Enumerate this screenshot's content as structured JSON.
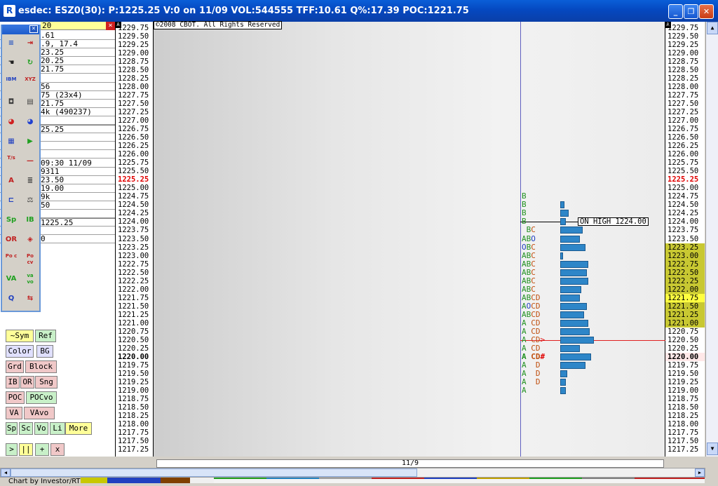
{
  "window": {
    "title": "esdec: ESZ0(30): P:1225.25 V:0 on 11/09 VOL:544555 TFF:10.61 Q%:17.39 POC:1221.75",
    "minimize": "_",
    "maximize": "❐",
    "close": "✕"
  },
  "left_panel": {
    "field_value": "20",
    "rows": [
      ".61",
      ".9, 17.4",
      "23.25",
      "20.25",
      "21.75",
      "",
      "56",
      "75 (23x4)",
      "21.75",
      "4k (490237)",
      "",
      "25.25",
      "",
      "",
      "",
      "09:30 11/09",
      "9311",
      "23.50",
      "19.00",
      "9k",
      "50",
      "",
      "1225.25",
      "",
      "0"
    ]
  },
  "toolbox": {
    "close": "×",
    "tools": [
      {
        "icon": "grid-lines-icon",
        "glyph": "≡",
        "color": "#2050c0"
      },
      {
        "icon": "import-arrow-icon",
        "glyph": "⇥",
        "color": "#c02020"
      },
      {
        "icon": "hand-icon",
        "glyph": "☚",
        "color": "#202020"
      },
      {
        "icon": "refresh-icon",
        "glyph": "↻",
        "color": "#20a020"
      },
      {
        "icon": "ibm-check-icon",
        "glyph": "IBM",
        "color": "#2040c0"
      },
      {
        "icon": "xyz-icon",
        "glyph": "XYZ",
        "color": "#c02020"
      },
      {
        "icon": "camera-icon",
        "glyph": "◘",
        "color": "#404040"
      },
      {
        "icon": "notepad-icon",
        "glyph": "▤",
        "color": "#404040"
      },
      {
        "icon": "color-wheel-icon",
        "glyph": "◕",
        "color": "#d02020"
      },
      {
        "icon": "color-wheel-2-icon",
        "glyph": "◕",
        "color": "#2040d0"
      },
      {
        "icon": "grid-icon",
        "glyph": "▦",
        "color": "#2040c0"
      },
      {
        "icon": "play-icon",
        "glyph": "▶",
        "color": "#20a020"
      },
      {
        "icon": "ts-icon",
        "glyph": "T/s",
        "color": "#c02020"
      },
      {
        "icon": "dash-icon",
        "glyph": "—",
        "color": "#c02020"
      },
      {
        "icon": "font-color-icon",
        "glyph": "A",
        "color": "#c02020"
      },
      {
        "icon": "align-icon",
        "glyph": "≣",
        "color": "#404040"
      },
      {
        "icon": "bracket-icon",
        "glyph": "⊏",
        "color": "#2040c0"
      },
      {
        "icon": "scales-icon",
        "glyph": "⚖",
        "color": "#404040"
      },
      {
        "icon": "sp-icon",
        "glyph": "Sp",
        "color": "#20a020"
      },
      {
        "icon": "ib-icon",
        "glyph": "IB",
        "color": "#20a020"
      },
      {
        "icon": "or-icon",
        "glyph": "OR",
        "color": "#c02020"
      },
      {
        "icon": "diamond-icon",
        "glyph": "◈",
        "color": "#c02020"
      },
      {
        "icon": "poc-icon",
        "glyph": "Po c",
        "color": "#c02020"
      },
      {
        "icon": "poc-cv-icon",
        "glyph": "Po cv",
        "color": "#c02020"
      },
      {
        "icon": "va-icon",
        "glyph": "VA",
        "color": "#20a020"
      },
      {
        "icon": "va-vo-icon",
        "glyph": "va vo",
        "color": "#20a020"
      },
      {
        "icon": "search-q-icon",
        "glyph": "Q",
        "color": "#2040c0"
      },
      {
        "icon": "swap-icon",
        "glyph": "⇆",
        "color": "#c02020"
      }
    ]
  },
  "buttons": [
    {
      "label": "~Sym",
      "bg": "#ffff99"
    },
    {
      "label": "Ref",
      "bg": "#c8f0c8"
    },
    {
      "label": "Color",
      "bg": "#e0e0ff"
    },
    {
      "label": "BG",
      "bg": "#e0e0ff"
    },
    {
      "label": "Grd",
      "bg": "#f0c8c8"
    },
    {
      "label": "Block",
      "bg": "#f0c8c8"
    },
    {
      "label": "IB",
      "bg": "#f0c8c8"
    },
    {
      "label": "OR",
      "bg": "#f0c8c8"
    },
    {
      "label": "Sng",
      "bg": "#f0c8c8"
    },
    {
      "label": "POC",
      "bg": "#f0c8c8"
    },
    {
      "label": "POCvo",
      "bg": "#c8f0c8"
    },
    {
      "label": "VA",
      "bg": "#f0c8c8"
    },
    {
      "label": "VAvo",
      "bg": "#f0c8c8"
    },
    {
      "label": "Sp",
      "bg": "#c8f0c8"
    },
    {
      "label": "Sc",
      "bg": "#c8f0c8"
    },
    {
      "label": "Vo",
      "bg": "#c8f0c8"
    },
    {
      "label": "Li",
      "bg": "#c8f0c8"
    },
    {
      "label": "More",
      "bg": "#ffff99"
    },
    {
      "label": ">",
      "bg": "#c8f0c8"
    },
    {
      "label": "||",
      "bg": "#ffff99"
    },
    {
      "label": "+",
      "bg": "#c8f0c8"
    },
    {
      "label": "x",
      "bg": "#f0c8c8"
    }
  ],
  "chart": {
    "copyright": "©2008 CBOT. All Rights Reserved",
    "date_label": "11/9",
    "on_high_label": "ON HIGH 1224.00",
    "last_price": "1225.25",
    "bold_price": "1220.00",
    "poc_price": "1221.75",
    "prices": [
      "1229.75",
      "1229.50",
      "1229.25",
      "1229.00",
      "1228.75",
      "1228.50",
      "1228.25",
      "1228.00",
      "1227.75",
      "1227.50",
      "1227.25",
      "1227.00",
      "1226.75",
      "1226.50",
      "1226.25",
      "1226.00",
      "1225.75",
      "1225.50",
      "1225.25",
      "1225.00",
      "1224.75",
      "1224.50",
      "1224.25",
      "1224.00",
      "1223.75",
      "1223.50",
      "1223.25",
      "1223.00",
      "1222.75",
      "1222.50",
      "1222.25",
      "1222.00",
      "1221.75",
      "1221.50",
      "1221.25",
      "1221.00",
      "1220.75",
      "1220.50",
      "1220.25",
      "1220.00",
      "1219.75",
      "1219.50",
      "1219.25",
      "1219.00",
      "1218.75",
      "1218.50",
      "1218.25",
      "1218.00",
      "1217.75",
      "1217.50",
      "1217.25"
    ],
    "value_area": [
      "1223.25",
      "1221.00"
    ],
    "profile": [
      {
        "price": "1224.75",
        "letters": "B",
        "volume": 0
      },
      {
        "price": "1224.50",
        "letters": "B",
        "volume": 3
      },
      {
        "price": "1224.25",
        "letters": "B",
        "volume": 6
      },
      {
        "price": "1224.00",
        "letters": "B",
        "volume": 4
      },
      {
        "price": "1223.75",
        "letters": " BC",
        "volume": 16
      },
      {
        "price": "1223.50",
        "letters": "ABO",
        "volume": 14
      },
      {
        "price": "1223.25",
        "letters": "OBC",
        "volume": 18
      },
      {
        "price": "1223.00",
        "letters": "ABC",
        "volume": 2
      },
      {
        "price": "1222.75",
        "letters": "ABC",
        "volume": 20
      },
      {
        "price": "1222.50",
        "letters": "ABC",
        "volume": 19
      },
      {
        "price": "1222.25",
        "letters": "ABC",
        "volume": 20
      },
      {
        "price": "1222.00",
        "letters": "ABC",
        "volume": 15
      },
      {
        "price": "1221.75",
        "letters": "ABCD",
        "volume": 14
      },
      {
        "price": "1221.50",
        "letters": "AOCD",
        "volume": 19
      },
      {
        "price": "1221.25",
        "letters": "ABCD",
        "volume": 17
      },
      {
        "price": "1221.00",
        "letters": "A CD",
        "volume": 20
      },
      {
        "price": "1220.75",
        "letters": "A CD",
        "volume": 21
      },
      {
        "price": "1220.50",
        "letters": "A CD>",
        "volume": 24
      },
      {
        "price": "1220.25",
        "letters": "A CD",
        "volume": 14
      },
      {
        "price": "1220.00",
        "letters": "A CD#",
        "volume": 22
      },
      {
        "price": "1219.75",
        "letters": "A  D",
        "volume": 18
      },
      {
        "price": "1219.50",
        "letters": "A  D",
        "volume": 5
      },
      {
        "price": "1219.25",
        "letters": "A  D",
        "volume": 4
      },
      {
        "price": "1219.00",
        "letters": "A",
        "volume": 4
      }
    ]
  },
  "status": {
    "text": "Chart by Investor/RT"
  },
  "colors": {
    "accent": "#0a4ec8",
    "value_area": "#c8c832",
    "profile_bar": "#2e86c8",
    "letter_a": "#209020",
    "letter_c": "#c05010",
    "red": "#e00000"
  }
}
